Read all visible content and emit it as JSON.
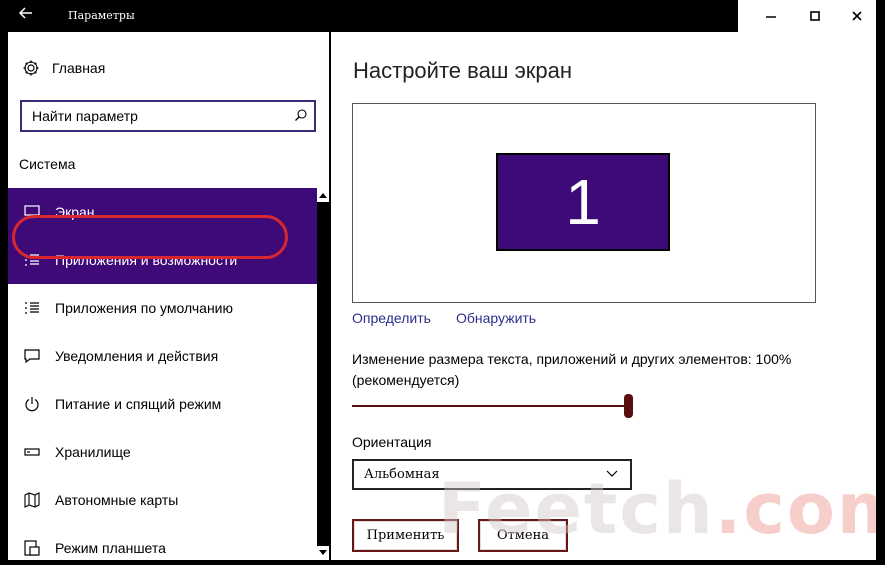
{
  "window": {
    "title": "Параметры"
  },
  "sidebar": {
    "home_label": "Главная",
    "search_placeholder": "Найти параметр",
    "section_title": "Система",
    "items": [
      {
        "label": "Экран",
        "icon": "monitor-icon",
        "active": true
      },
      {
        "label": "Приложения и возможности",
        "icon": "list-icon",
        "active": false
      },
      {
        "label": "Приложения по умолчанию",
        "icon": "list-default-icon",
        "active": false
      },
      {
        "label": "Уведомления и действия",
        "icon": "notification-icon",
        "active": false
      },
      {
        "label": "Питание и спящий режим",
        "icon": "power-icon",
        "active": false
      },
      {
        "label": "Хранилище",
        "icon": "storage-icon",
        "active": false
      },
      {
        "label": "Автономные карты",
        "icon": "map-icon",
        "active": false
      },
      {
        "label": "Режим планшета",
        "icon": "tablet-icon",
        "active": false
      }
    ]
  },
  "main": {
    "title": "Настройте ваш экран",
    "display_number": "1",
    "identify_link": "Определить",
    "detect_link": "Обнаружить",
    "scale_label": "Изменение размера текста, приложений и других элементов: 100% (рекомендуется)",
    "scale_value_percent": 100,
    "orientation_label": "Ориентация",
    "orientation_value": "Альбомная",
    "apply_button": "Применить",
    "cancel_button": "Отмена"
  },
  "watermark": {
    "text_main": "Feetch",
    "text_accent": ".com"
  },
  "colors": {
    "accent": "#3d0a78",
    "highlight_ring": "#d8272e",
    "slider": "#5a0e0e"
  }
}
